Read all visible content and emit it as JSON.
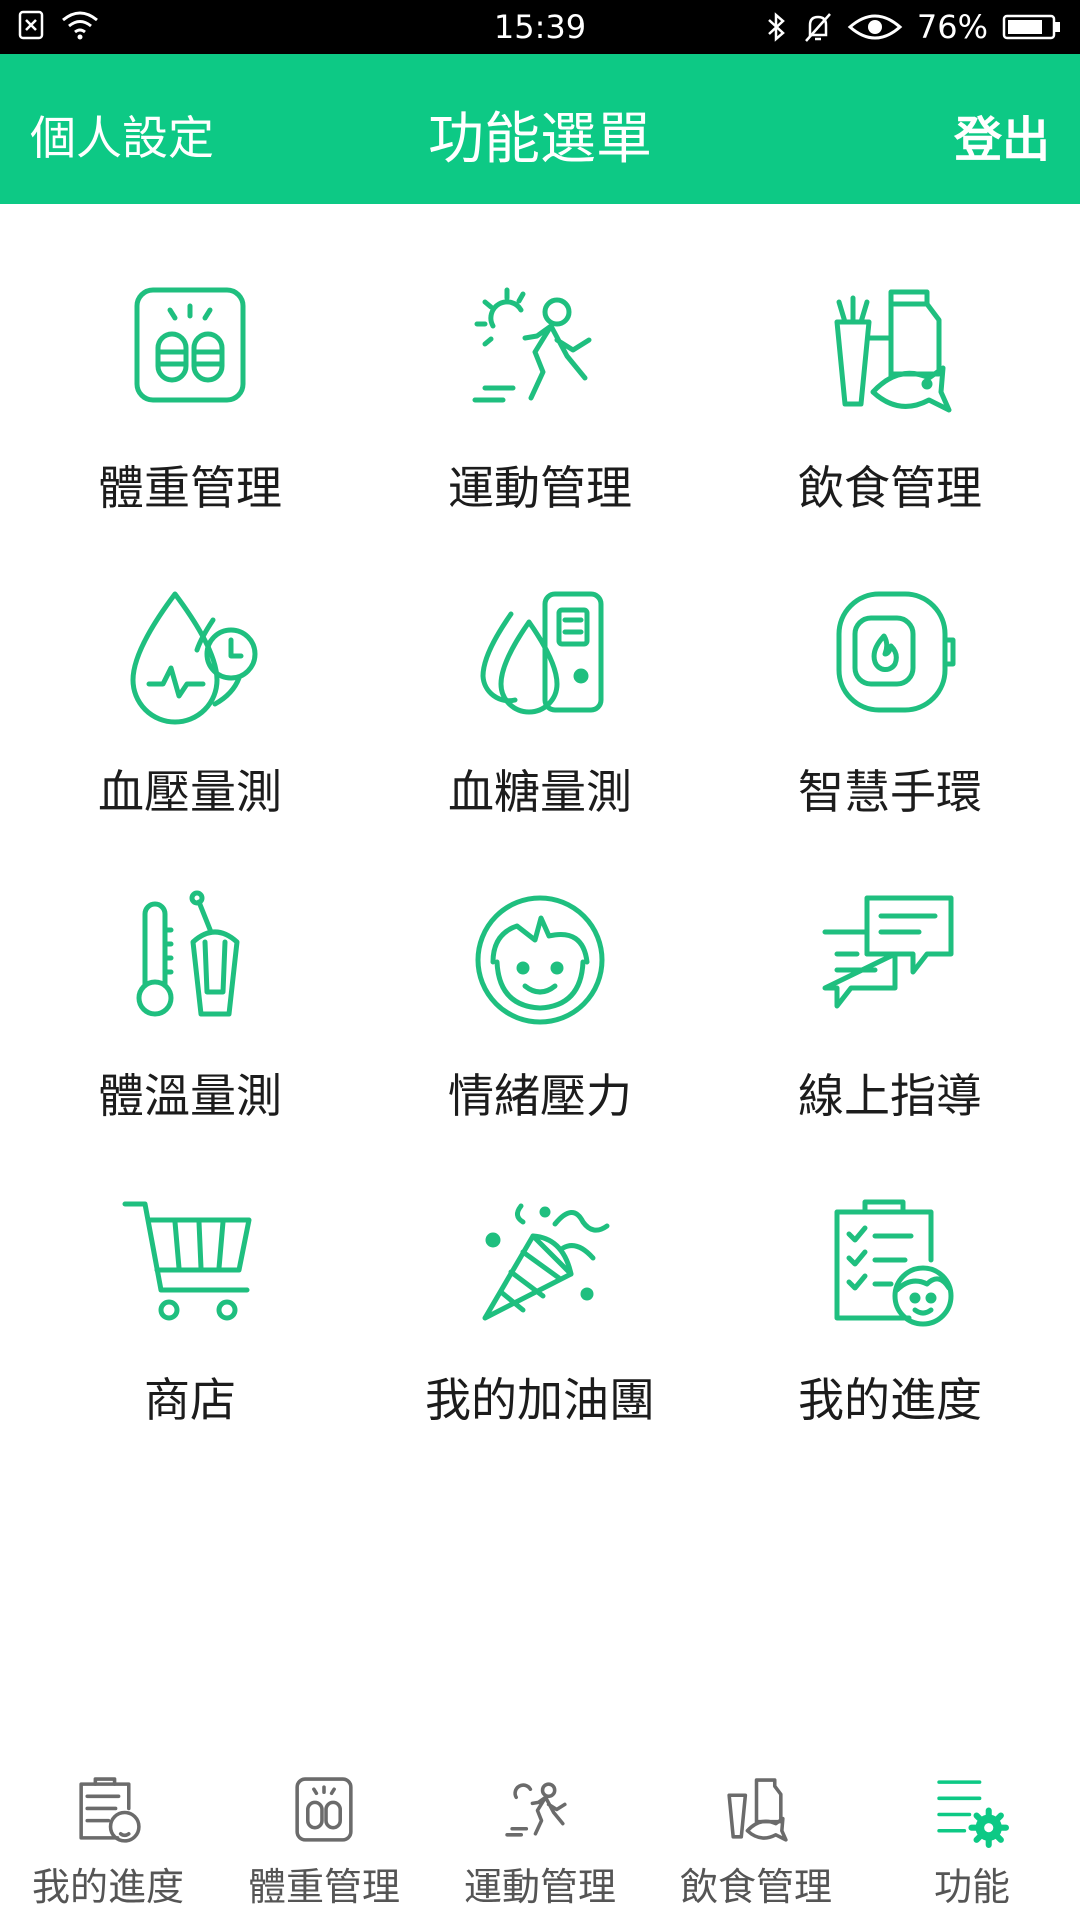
{
  "status_bar": {
    "time": "15:39",
    "battery": "76%",
    "icons": [
      "sim-off-icon",
      "wifi-icon",
      "bluetooth-icon",
      "bell-muted-icon",
      "eye-icon",
      "battery-icon"
    ]
  },
  "header": {
    "left": "個人設定",
    "title": "功能選單",
    "right": "登出"
  },
  "menu": [
    {
      "label": "體重管理",
      "icon": "scale-icon"
    },
    {
      "label": "運動管理",
      "icon": "running-icon"
    },
    {
      "label": "飲食管理",
      "icon": "food-icon"
    },
    {
      "label": "血壓量測",
      "icon": "blood-pressure-icon"
    },
    {
      "label": "血糖量測",
      "icon": "blood-sugar-icon"
    },
    {
      "label": "智慧手環",
      "icon": "smart-band-icon"
    },
    {
      "label": "體溫量測",
      "icon": "thermometer-icon"
    },
    {
      "label": "情緒壓力",
      "icon": "mood-face-icon"
    },
    {
      "label": "線上指導",
      "icon": "chat-icon"
    },
    {
      "label": "商店",
      "icon": "cart-icon"
    },
    {
      "label": "我的加油團",
      "icon": "party-popper-icon"
    },
    {
      "label": "我的進度",
      "icon": "progress-clipboard-icon"
    }
  ],
  "bottom_nav": [
    {
      "label": "我的進度",
      "icon": "progress-clipboard-icon"
    },
    {
      "label": "體重管理",
      "icon": "scale-icon"
    },
    {
      "label": "運動管理",
      "icon": "running-icon"
    },
    {
      "label": "飲食管理",
      "icon": "food-icon"
    },
    {
      "label": "功能",
      "icon": "menu-gear-icon"
    }
  ],
  "colors": {
    "accent": "#0dc985",
    "icon_green": "#1fbf7f",
    "nav_gray": "#6b6b6b"
  }
}
